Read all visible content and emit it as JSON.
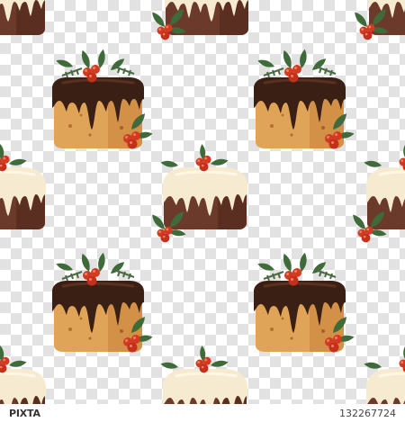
{
  "watermark": {
    "brand": "PIXTA",
    "image_id": "132267724"
  },
  "pattern": {
    "checker_light": "#ffffff",
    "checker_dark": "#e2e2e2"
  },
  "colors": {
    "chocolate_glaze": "#3a1f15",
    "chocolate_glaze_highlight": "#5a3120",
    "fruit_cake_light": "#e0a458",
    "fruit_cake_dark": "#c9813a",
    "dark_pudding": "#6b3a2a",
    "dark_pudding_shadow": "#4a2418",
    "white_icing": "#f6ead1",
    "holly_leaf": "#3f6b3a",
    "holly_leaf_light": "#6f9857",
    "berry_red": "#d23a22",
    "pine_green": "#4b6b43"
  },
  "motifs": [
    {
      "name": "chocolate-glazed-cake",
      "description_icons": [
        "holly-icon",
        "berry-icon",
        "pine-sprig-icon"
      ]
    },
    {
      "name": "white-iced-pudding",
      "description_icons": [
        "holly-icon",
        "berry-icon"
      ]
    }
  ]
}
